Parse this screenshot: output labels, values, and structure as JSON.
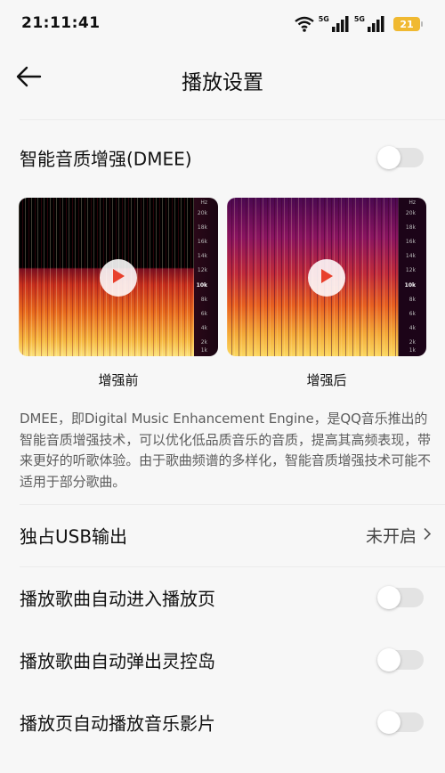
{
  "status_bar": {
    "time": "21:11:41",
    "net1": "5G",
    "net2": "5G",
    "battery": "21",
    "battery_color": "#f0b931"
  },
  "header": {
    "title": "播放设置",
    "back_icon": "arrow-left-icon"
  },
  "dmee": {
    "label": "智能音质增强(DMEE)",
    "enabled": false,
    "before_caption": "增强前",
    "after_caption": "增强后",
    "freq_axis_unit": "Hz",
    "freq_ticks": [
      "20k",
      "18k",
      "16k",
      "14k",
      "12k",
      "10k",
      "8k",
      "6k",
      "4k",
      "2k",
      "1k"
    ],
    "description": "DMEE，即Digital Music Enhancement Engine，是QQ音乐推出的智能音质增强技术，可以优化低品质音乐的音质，提高其高频表现，带来更好的听歌体验。由于歌曲频谱的多样化，智能音质增强技术可能不适用于部分歌曲。"
  },
  "settings": [
    {
      "label": "独占USB输出",
      "value": "未开启",
      "type": "link"
    },
    {
      "label": "播放歌曲自动进入播放页",
      "enabled": false,
      "type": "toggle"
    },
    {
      "label": "播放歌曲自动弹出灵控岛",
      "enabled": false,
      "type": "toggle"
    },
    {
      "label": "播放页自动播放音乐影片",
      "enabled": false,
      "type": "toggle"
    }
  ],
  "colors": {
    "play_triangle": "#e8402c",
    "toggle_off_track": "#e3e3e3"
  }
}
